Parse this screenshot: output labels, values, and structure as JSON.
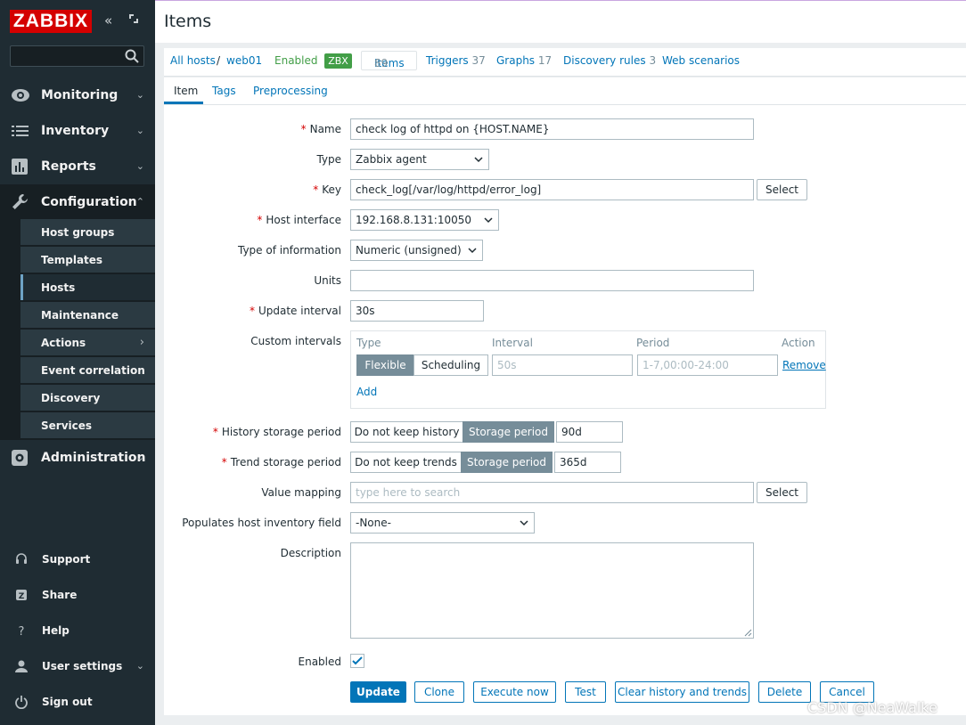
{
  "sidebar": {
    "logo": "ZABBIX",
    "menu": [
      {
        "label": "Monitoring"
      },
      {
        "label": "Inventory"
      },
      {
        "label": "Reports"
      },
      {
        "label": "Configuration"
      },
      {
        "label": "Administration"
      }
    ],
    "submenu": [
      {
        "label": "Host groups"
      },
      {
        "label": "Templates"
      },
      {
        "label": "Hosts"
      },
      {
        "label": "Maintenance"
      },
      {
        "label": "Actions"
      },
      {
        "label": "Event correlation"
      },
      {
        "label": "Discovery"
      },
      {
        "label": "Services"
      }
    ],
    "footer": [
      {
        "label": "Support"
      },
      {
        "label": "Share"
      },
      {
        "label": "Help"
      },
      {
        "label": "User settings"
      },
      {
        "label": "Sign out"
      }
    ]
  },
  "header": {
    "title": "Items"
  },
  "nav": {
    "all_hosts": "All hosts",
    "sep": "/",
    "host": "web01",
    "status": "Enabled",
    "zbx": "ZBX",
    "items": "Items",
    "items_count": "89",
    "triggers": "Triggers",
    "triggers_count": "37",
    "graphs": "Graphs",
    "graphs_count": "17",
    "discovery": "Discovery rules",
    "discovery_count": "3",
    "web": "Web scenarios"
  },
  "tabs": [
    "Item",
    "Tags",
    "Preprocessing"
  ],
  "form": {
    "name_label": "Name",
    "name_value": "check log of httpd on {HOST.NAME}",
    "type_label": "Type",
    "type_value": "Zabbix agent",
    "key_label": "Key",
    "key_value": "check_log[/var/log/httpd/error_log]",
    "select_label": "Select",
    "host_interface_label": "Host interface",
    "host_interface_value": "192.168.8.131:10050",
    "type_info_label": "Type of information",
    "type_info_value": "Numeric (unsigned)",
    "units_label": "Units",
    "units_value": "",
    "update_interval_label": "Update interval",
    "update_interval_value": "30s",
    "custom_intervals_label": "Custom intervals",
    "ci_type": "Type",
    "ci_interval": "Interval",
    "ci_period": "Period",
    "ci_action": "Action",
    "ci_flexible": "Flexible",
    "ci_scheduling": "Scheduling",
    "ci_interval_placeholder": "50s",
    "ci_period_placeholder": "1-7,00:00-24:00",
    "ci_remove": "Remove",
    "ci_add": "Add",
    "history_label": "History storage period",
    "history_off": "Do not keep history",
    "history_on": "Storage period",
    "history_value": "90d",
    "trend_label": "Trend storage period",
    "trend_off": "Do not keep trends",
    "trend_on": "Storage period",
    "trend_value": "365d",
    "value_mapping_label": "Value mapping",
    "value_mapping_placeholder": "type here to search",
    "inventory_label": "Populates host inventory field",
    "inventory_value": "-None-",
    "description_label": "Description",
    "enabled_label": "Enabled",
    "enabled": true
  },
  "actions": {
    "update": "Update",
    "clone": "Clone",
    "execute_now": "Execute now",
    "test": "Test",
    "clear": "Clear history and trends",
    "delete": "Delete",
    "cancel": "Cancel"
  },
  "watermark": "CSDN @NeaWalke",
  "colors": {
    "sidebar_bg": "#1f2c33",
    "logo_red": "#d40000",
    "link_blue": "#0275b8",
    "enabled_green": "#429e47",
    "segment_on": "#768d99"
  }
}
